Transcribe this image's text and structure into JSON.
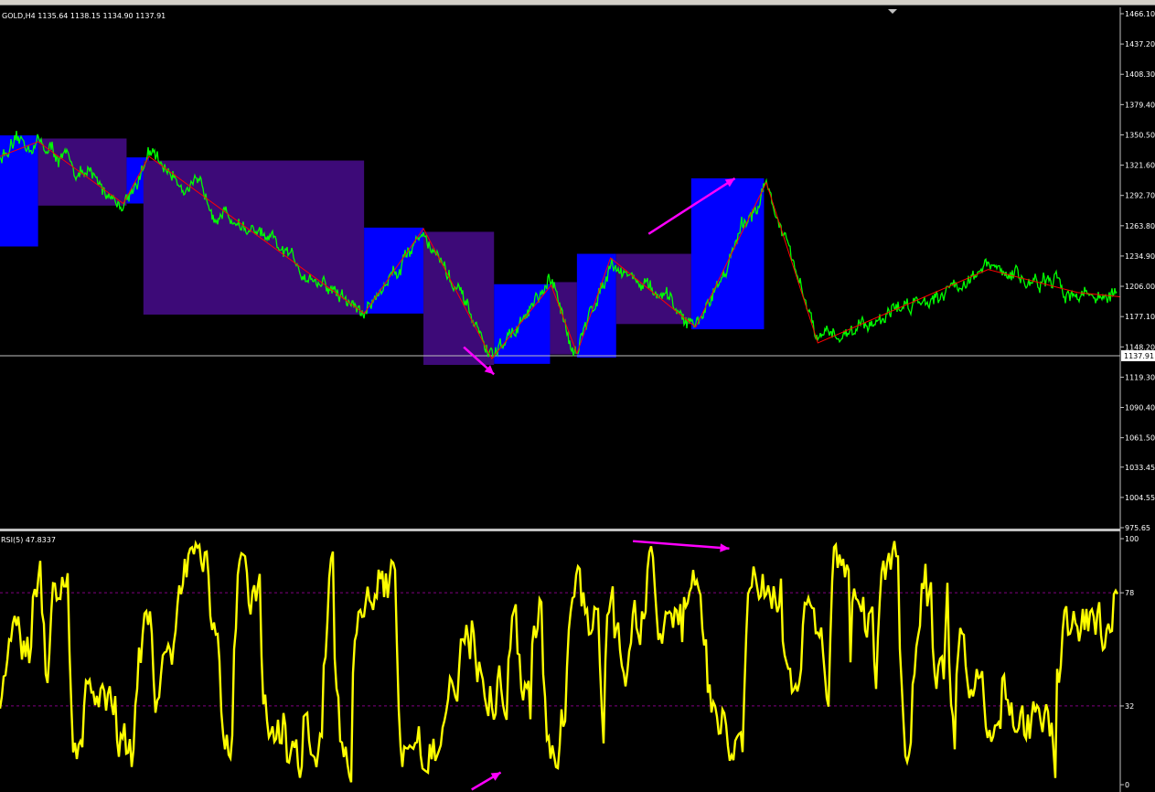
{
  "window": {
    "symbol_header": "GOLD,H4  1135.64 1138.15 1134.90 1137.91",
    "indicator_header": "RSI(5) 47.8337"
  },
  "colors": {
    "background": "#000000",
    "price_line": "#00ff00",
    "zigzag": "#ff0000",
    "indicator_line": "#ffff00",
    "arrow": "#ff00ff",
    "box_up": "#0000ff",
    "box_down": "#3d0a78",
    "current_price_line": "#c0c0c0",
    "level_line": "#800080"
  },
  "chart_data": [
    {
      "type": "line",
      "title": "GOLD,H4",
      "ylim": [
        965,
        1470
      ],
      "y_ticks": [
        "1466.10",
        "1437.20",
        "1408.30",
        "1379.40",
        "1350.50",
        "1321.60",
        "1292.70",
        "1263.80",
        "1234.90",
        "1206.00",
        "1177.10",
        "1148.20",
        "1119.30",
        "1090.40",
        "1061.50",
        "1033.45",
        "1004.55",
        "975.65"
      ],
      "current_price": "1137.91",
      "zigzag": {
        "x": [
          0.0,
          0.034,
          0.11,
          0.133,
          0.325,
          0.378,
          0.439,
          0.492,
          0.515,
          0.545,
          0.621,
          0.684,
          0.73,
          0.882,
          0.962,
          1.0
        ],
        "y": [
          1330,
          1344,
          1285,
          1330,
          1180,
          1261,
          1137,
          1207,
          1142,
          1233,
          1167,
          1305,
          1152,
          1222,
          1200,
          1196
        ]
      },
      "boxes": [
        {
          "x0": 0.0,
          "x1": 0.034,
          "y_high": 1350,
          "y_low": 1244,
          "kind": "up"
        },
        {
          "x0": 0.034,
          "x1": 0.113,
          "y_high": 1347,
          "y_low": 1283,
          "kind": "down"
        },
        {
          "x0": 0.113,
          "x1": 0.133,
          "y_high": 1329,
          "y_low": 1285,
          "kind": "up"
        },
        {
          "x0": 0.128,
          "x1": 0.325,
          "y_high": 1326,
          "y_low": 1179,
          "kind": "down"
        },
        {
          "x0": 0.325,
          "x1": 0.378,
          "y_high": 1262,
          "y_low": 1180,
          "kind": "up"
        },
        {
          "x0": 0.378,
          "x1": 0.441,
          "y_high": 1258,
          "y_low": 1131,
          "kind": "down"
        },
        {
          "x0": 0.441,
          "x1": 0.491,
          "y_high": 1208,
          "y_low": 1132,
          "kind": "up"
        },
        {
          "x0": 0.491,
          "x1": 0.515,
          "y_high": 1210,
          "y_low": 1141,
          "kind": "down"
        },
        {
          "x0": 0.515,
          "x1": 0.55,
          "y_high": 1237,
          "y_low": 1138,
          "kind": "up"
        },
        {
          "x0": 0.55,
          "x1": 0.617,
          "y_high": 1237,
          "y_low": 1170,
          "kind": "down"
        },
        {
          "x0": 0.617,
          "x1": 0.682,
          "y_high": 1309,
          "y_low": 1165,
          "kind": "up"
        }
      ],
      "arrows": [
        {
          "x0": 0.414,
          "y0": 1148,
          "x1": 0.441,
          "y1": 1122
        },
        {
          "x0": 0.579,
          "y0": 1256,
          "x1": 0.656,
          "y1": 1309
        }
      ]
    },
    {
      "type": "line",
      "title": "RSI(5)",
      "ylim": [
        0,
        100
      ],
      "y_ticks": [
        "100",
        "78",
        "32",
        "0"
      ],
      "levels": [
        78,
        32
      ],
      "last_value": 47.8337,
      "arrows": [
        {
          "x0": 0.565,
          "y0": 99,
          "x1": 0.651,
          "y1": 96
        },
        {
          "x0": 0.421,
          "y0": -2,
          "x1": 0.447,
          "y1": 5
        }
      ]
    }
  ]
}
